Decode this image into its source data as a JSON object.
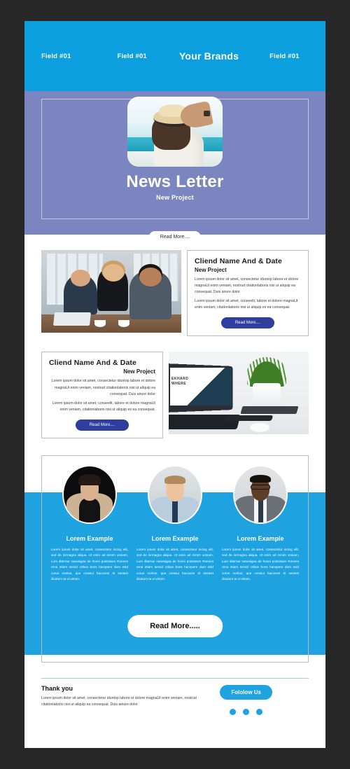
{
  "header": {
    "links": [
      {
        "label": "Field #01"
      },
      {
        "label": "Field #01"
      },
      {
        "label": "Field #01"
      }
    ],
    "brand": "Your Brands",
    "bg_color": "#0b9fe0"
  },
  "hero": {
    "title": "News Letter",
    "subtitle": "New Project",
    "button": "Read More....",
    "bg_color": "#7b85bf",
    "image_name": "woman-with-hat-beach-photo"
  },
  "blocks": [
    {
      "title": "Cliend Name And & Date",
      "subtitle": "New Project",
      "paragraph1": "Lorem ipsum dolor sit amet, consectetur iduntop labore et dolore magnaUt enim veniam, nostrud citationlaboris nisi ut aliquip ea consequat. Duis airure dolor",
      "paragraph2": "Lorem ipsum dolor sit amet, conseelit, labore et dolore magnaUt enim veniam, citationlaboris nisi ut aliquip ex ea consequat.",
      "button": "Read More....",
      "image_name": "team-meeting-photo",
      "button_color": "#2f3d9e"
    },
    {
      "title": "Cliend Name And & Date",
      "subtitle": "New Project",
      "paragraph1": "Lorem ipsum dolor sit amet, consectetur iduntop labore et dolore magnaUt enim veniam, nostrud citationlaboris nisi ut aliquip ea consequat. Duis airure dolor",
      "paragraph2": "Lorem ipsum dolor sit amet, conseelit, labore et dolore magnaUt enim veniam, citationlaboris nisi ut aliquip ex ea consequat.",
      "button": "Read More....",
      "image_name": "desk-laptop-plant-photo",
      "screen_text": "EKHARD\nWHERE",
      "button_color": "#2f3d9e"
    }
  ],
  "team": {
    "band_color": "#1ea2e0",
    "members": [
      {
        "name": "Lorem Example",
        "avatar_name": "avatar-man-beige-blazer",
        "text": "Lorem ipsum dolor sit amet, consectetur incing elit, sed do lormagna aliqua. Ut enim ad minim veniam, Lum diterrae nanesigna de honei postratum Ronnes rena etiam servid cribus bons hacepere dum esid corun noritus, que cressui hacoves! Si sestest dicatum ta vi-virtom."
      },
      {
        "name": "Lorem Example",
        "avatar_name": "avatar-man-blue-shirt",
        "text": "Lorem ipsum dolor sit amet, consectetur incing elit, sed do lormagna aliqua. Ut enim ad minim veniam, Lum diterrae nanesigna de honei postratum Ronnes rena etiam servid cribus bons hacepere dum esid corun noritus, que cressui hacoves! Si sestest dicatum ta vi-virtom."
      },
      {
        "name": "Lorem Example",
        "avatar_name": "avatar-man-grey-suit-glasses",
        "text": "Lorem ipsum dolor sit amet, consectetur incing elit, sed do lormagna aliqua. Ut enim ad minim veniam, Lum diterrae nanesigna de honei postratum Ronnes rena etiam servid cribus bons hacepere dum esid corun noritus, que cressui hacoves! Si sestest dicatum ta vi-virtom."
      }
    ],
    "button": "Read More....."
  },
  "footer": {
    "title": "Thank you",
    "paragraph": "Lorem ipsum dolor sit amet, consectetur iduntop labore et dolore magnaUt enim veniam, nostrud citationlaboris nisi ut aliquip ea consequat. Duis ainure dolor",
    "follow_button": "Fololow Us",
    "dots": [
      "social-dot-1",
      "social-dot-2",
      "social-dot-3"
    ],
    "accent_color": "#1ea2e0"
  }
}
